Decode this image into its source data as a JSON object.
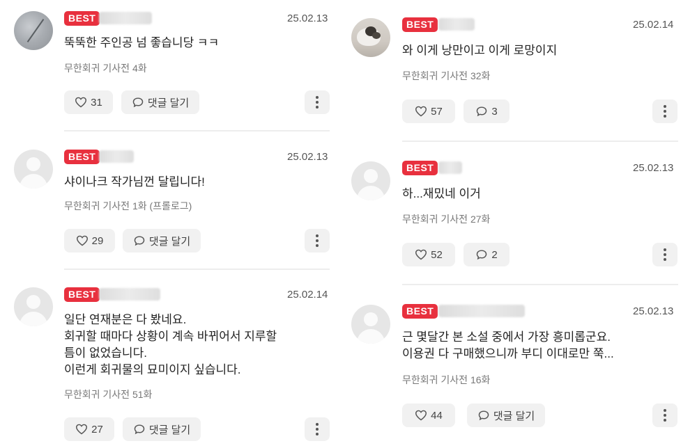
{
  "badge": "BEST",
  "reply_label": "댓글 달기",
  "left": [
    {
      "date": "25.02.13",
      "text": "뚝뚝한 주인공 넘 좋습니당 ㅋㅋ",
      "meta": "무한회귀 기사전 4화",
      "likes": "31",
      "replies": null,
      "avatar": "photo-snow"
    },
    {
      "date": "25.02.13",
      "text": "샤이나크 작가님껀 달립니다!",
      "meta": "무한회귀 기사전 1화 (프롤로그)",
      "likes": "29",
      "replies": null,
      "avatar": "default"
    },
    {
      "date": "25.02.14",
      "text": "일단 연재분은 다 봤네요.\n회귀할 때마다 상황이 계속 바뀌어서 지루할\n틈이 없었습니다.\n이런게 회귀물의 묘미이지 싶습니다.",
      "meta": "무한회귀 기사전 51화",
      "likes": "27",
      "replies": null,
      "avatar": "default"
    }
  ],
  "right": [
    {
      "date": "25.02.14",
      "text": "와 이게 낭만이고 이게 로망이지",
      "meta": "무한회귀 기사전 32화",
      "likes": "57",
      "replies": "3",
      "avatar": "photo-cat"
    },
    {
      "date": "25.02.13",
      "text": "하...재밌네 이거",
      "meta": "무한회귀 기사전 27화",
      "likes": "52",
      "replies": "2",
      "avatar": "default"
    },
    {
      "date": "25.02.13",
      "text": "근 몇달간 본 소설 중에서 가장 흥미롭군요.\n이용권 다 구매했으니까 부디 이대로만 쭉...",
      "meta": "무한회귀 기사전 16화",
      "likes": "44",
      "replies": null,
      "avatar": "default"
    }
  ]
}
